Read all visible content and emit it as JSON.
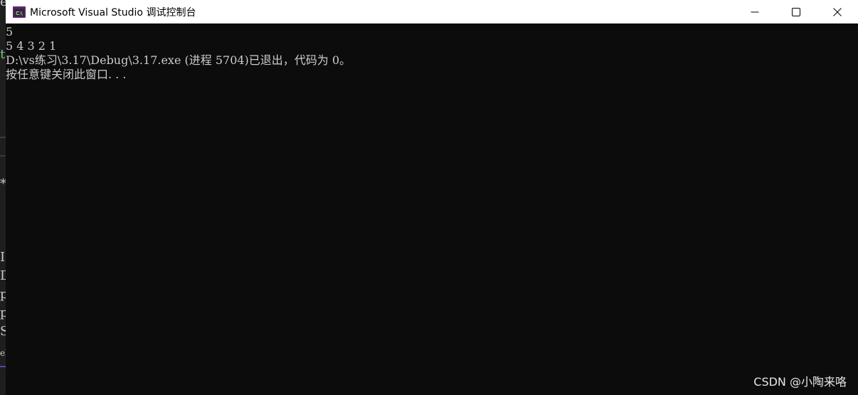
{
  "window": {
    "title": "Microsoft Visual Studio 调试控制台",
    "icon": "console-app-icon",
    "controls": [
      "minimize-icon",
      "maximize-icon",
      "close-icon"
    ]
  },
  "console": {
    "lines": [
      "5",
      "5 4 3 2 1",
      "D:\\vs练习\\3.17\\Debug\\3.17.exe (进程 5704)已退出，代码为 0。",
      "按任意键关闭此窗口. . ."
    ]
  },
  "background_editor": {
    "fragments": [
      "e",
      "t",
      "*",
      "I",
      "D",
      "p",
      "p",
      "S",
      "el"
    ]
  },
  "watermark": {
    "text": "CSDN @小陶来咯"
  },
  "colors": {
    "console_background": "#0c0c0c",
    "console_text": "#cccccc",
    "title_bar": "#ffffff",
    "icon_purple": "#68217a"
  }
}
